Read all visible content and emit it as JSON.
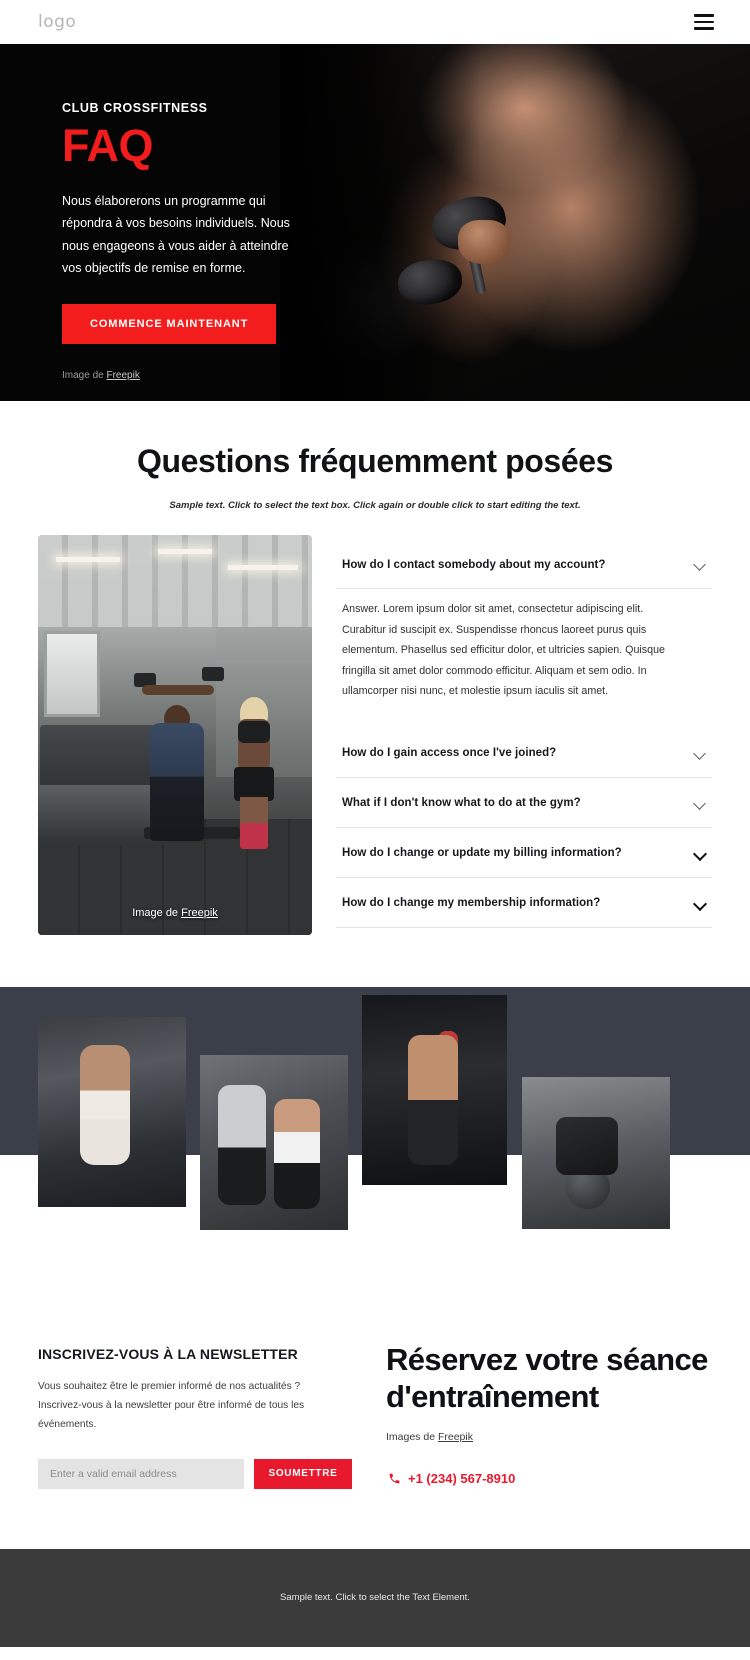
{
  "header": {
    "logo": "logo",
    "menu_icon": "hamburger-menu-icon"
  },
  "hero": {
    "eyebrow": "CLUB CROSSFITNESS",
    "title": "FAQ",
    "description": "Nous élaborerons un programme qui répondra à vos besoins individuels. Nous nous engageons à vous aider à atteindre vos objectifs de remise en forme.",
    "cta_label": "COMMENCE MAINTENANT",
    "credit_prefix": "Image de ",
    "credit_link": "Freepik"
  },
  "faq": {
    "title": "Questions fréquemment posées",
    "subtitle": "Sample text. Click to select the text box. Click again or double click to start editing the text.",
    "photo_credit_prefix": "Image de ",
    "photo_credit_link": "Freepik",
    "items": [
      {
        "question": "How do I contact somebody about my account?",
        "answer": "Answer. Lorem ipsum dolor sit amet, consectetur adipiscing elit. Curabitur id suscipit ex. Suspendisse rhoncus laoreet purus quis elementum. Phasellus sed efficitur dolor, et ultricies sapien. Quisque fringilla sit amet dolor commodo efficitur. Aliquam et sem odio. In ullamcorper nisi nunc, et molestie ipsum iaculis sit amet.",
        "open": true
      },
      {
        "question": "How do I gain access once I've joined?",
        "answer": "",
        "open": false
      },
      {
        "question": "What if I don't know what to do at the gym?",
        "answer": "",
        "open": false
      },
      {
        "question": "How do I change or update my billing information?",
        "answer": "",
        "open": false
      },
      {
        "question": "How do I change my membership information?",
        "answer": "",
        "open": false
      }
    ]
  },
  "gallery": {
    "images": [
      "gym-woman-cable-machine",
      "trainer-coaching-woman-dumbbell",
      "athlete-with-battle-rope",
      "man-medicine-ball-workout"
    ]
  },
  "newsletter": {
    "heading": "INSCRIVEZ-VOUS À LA NEWSLETTER",
    "paragraph": "Vous souhaitez être le premier informé de nos actualités ? Inscrivez-vous à la newsletter pour être informé de tous les événements.",
    "input_placeholder": "Enter a valid email address",
    "input_value": "",
    "submit_label": "SOUMETTRE"
  },
  "booking": {
    "heading": "Réservez votre séance d'entraînement",
    "credit_prefix": "Images de ",
    "credit_link": "Freepik",
    "phone": "+1 (234) 567-8910",
    "phone_icon": "phone-icon"
  },
  "footer": {
    "text": "Sample text. Click to select the Text Element."
  },
  "colors": {
    "accent_red": "#f41d1d",
    "button_red": "#e8192c",
    "hero_bg": "#050505",
    "band_dark": "#3b3f49",
    "footer_bg": "#3b3b3b"
  }
}
